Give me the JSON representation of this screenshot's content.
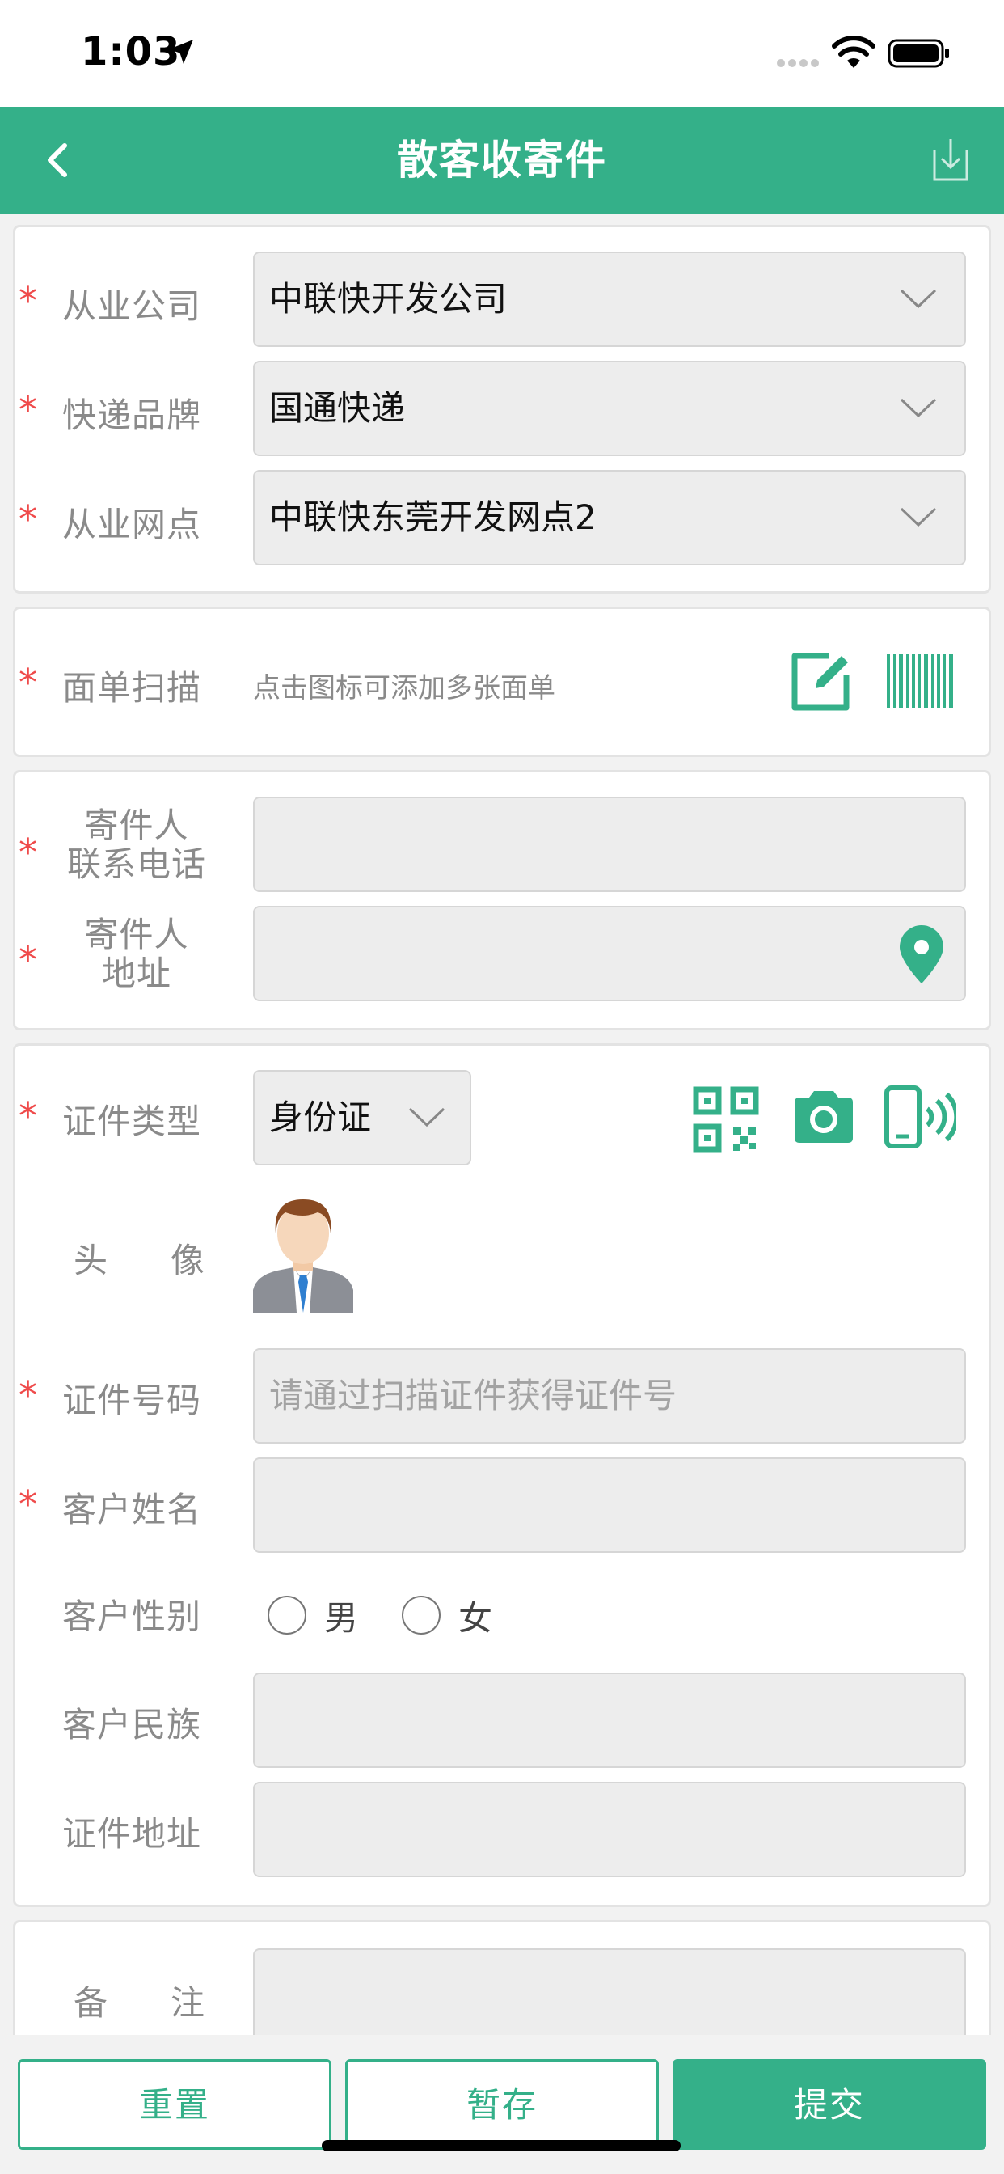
{
  "status": {
    "time": "1:03"
  },
  "nav": {
    "title": "散客收寄件"
  },
  "company_card": {
    "company": {
      "label": "从业公司",
      "value": "中联快开发公司"
    },
    "brand": {
      "label": "快递品牌",
      "value": "国通快递"
    },
    "outlet": {
      "label": "从业网点",
      "value": "中联快东莞开发网点2"
    }
  },
  "scan_card": {
    "label": "面单扫描",
    "hint": "点击图标可添加多张面单"
  },
  "sender_card": {
    "phone_label_1": "寄件人",
    "phone_label_2": "联系电话",
    "phone_value": "",
    "addr_label_1": "寄件人",
    "addr_label_2": "地址",
    "addr_value": ""
  },
  "id_card": {
    "type_label": "证件类型",
    "type_value": "身份证",
    "avatar_label_1": "头",
    "avatar_label_2": "像",
    "number_label": "证件号码",
    "number_placeholder": "请通过扫描证件获得证件号",
    "name_label": "客户姓名",
    "gender_label": "客户性别",
    "gender_male": "男",
    "gender_female": "女",
    "ethnicity_label": "客户民族",
    "address_label": "证件地址"
  },
  "remark_card": {
    "label_1": "备",
    "label_2": "注"
  },
  "buttons": {
    "reset": "重置",
    "save": "暂存",
    "submit": "提交"
  },
  "colors": {
    "accent": "#34b089",
    "required": "#ef4a4a"
  }
}
